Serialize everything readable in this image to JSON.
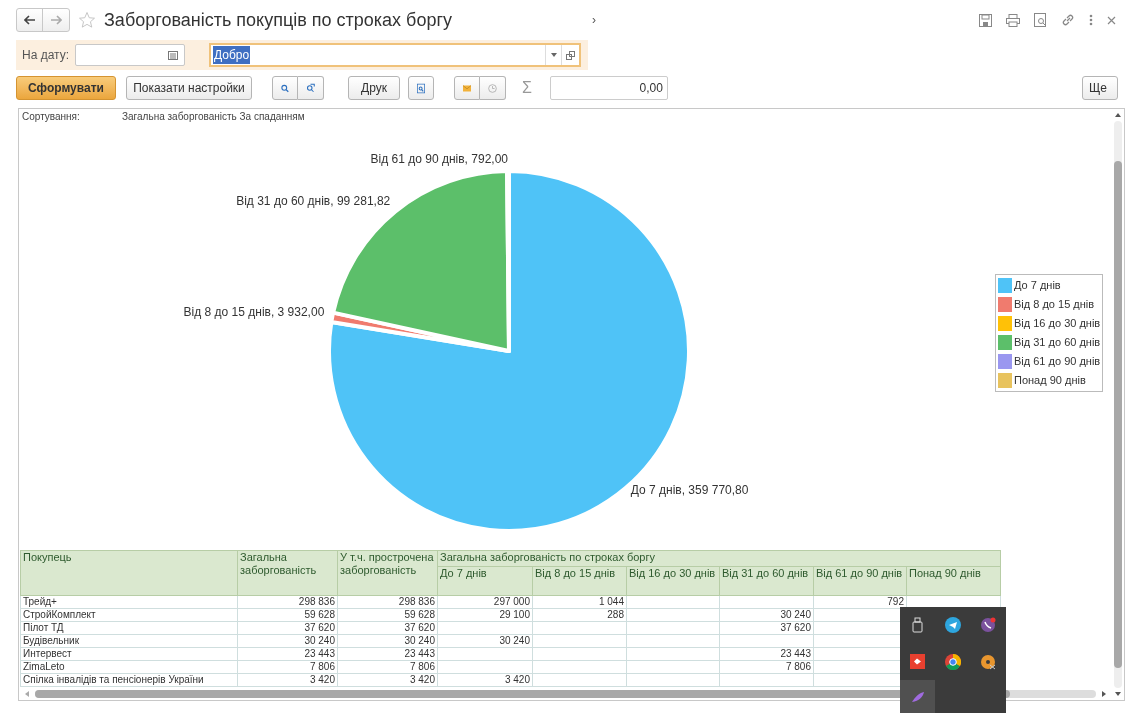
{
  "title_bar": {
    "title": "Заборгованість покупців по строках боргу",
    "trailing_mark": "›",
    "favorite": false
  },
  "filter": {
    "date_label": "На дату:",
    "organization": "Добро"
  },
  "toolbar": {
    "generate": "Сформувати",
    "show_settings": "Показати настройки",
    "print": "Друк",
    "sum_symbol": "Σ",
    "sum_value": "0,00",
    "more": "Ще"
  },
  "report": {
    "sort_label": "Сортування:",
    "sort_value": "Загальна заборгованість За спаданням",
    "chart_data": {
      "type": "pie",
      "categories": [
        "До 7 днів",
        "Від 8 до 15 днів",
        "Від 16 до 30 днів",
        "Від 31 до 60 днів",
        "Від 61 до 90 днів",
        "Понад 90 днів"
      ],
      "values": [
        359770.8,
        3932,
        0,
        99281.82,
        792,
        0
      ],
      "colors": [
        "#4fc3f7",
        "#f07b6e",
        "#ffc107",
        "#5cbf6a",
        "#9a97f0",
        "#e8c35e"
      ],
      "legend": "right",
      "value_labels": [
        "До 7 днів, 359 770,80",
        "Від 8 до 15 днів, 3 932,00",
        null,
        "Від 31 до 60 днів, 99 281,82",
        "Від 61 до 90 днів, 792,00",
        null
      ]
    },
    "table": {
      "buyer": "Покупець",
      "total": "Загальна заборгованість",
      "overdue": "У т.ч. прострочена заборгованість",
      "group": "Загальна заборгованість по строках боргу",
      "periods": [
        "До 7 днів",
        "Від 8 до 15 днів",
        "Від 16 до 30 днів",
        "Від 31 до 60 днів",
        "Від 61 до 90 днів",
        "Понад 90 днів"
      ],
      "rows": [
        {
          "buyer": "Трейд+",
          "cells": [
            "298 836",
            "298 836",
            "297 000",
            "1 044",
            null,
            null,
            "792",
            null
          ]
        },
        {
          "buyer": "СтройКомплект",
          "cells": [
            "59 628",
            "59 628",
            "29 100",
            "288",
            null,
            "30 240",
            null,
            null
          ]
        },
        {
          "buyer": "Пілот ТД",
          "cells": [
            "37 620",
            "37 620",
            null,
            null,
            null,
            "37 620",
            null,
            null
          ]
        },
        {
          "buyer": "Будівельник",
          "cells": [
            "30 240",
            "30 240",
            "30 240",
            null,
            null,
            null,
            null,
            null
          ]
        },
        {
          "buyer": "Интервест",
          "cells": [
            "23 443",
            "23 443",
            null,
            null,
            null,
            "23 443",
            null,
            null
          ]
        },
        {
          "buyer": "ZimaLeto",
          "cells": [
            "7 806",
            "7 806",
            null,
            null,
            null,
            "7 806",
            null,
            null
          ]
        },
        {
          "buyer": "Спілка інвалідів та пенсіонерів України",
          "cells": [
            "3 420",
            "3 420",
            "3 420",
            null,
            null,
            null,
            null,
            null
          ]
        }
      ]
    }
  }
}
